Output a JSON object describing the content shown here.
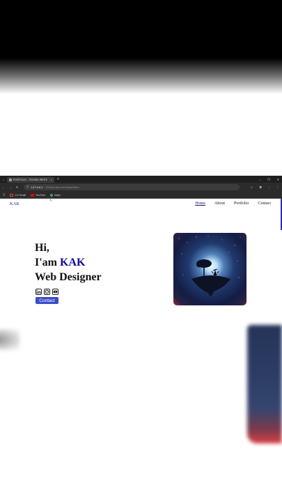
{
  "browser": {
    "tab_title": "PORTFOLIO - TECHNO WRITE",
    "tab_close": "×",
    "new_tab": "+",
    "url_host": "127.0.0.1",
    "url_path": ":5500/index.html#portfolio",
    "bookmarks": [
      {
        "label": "J-K Gmail",
        "icon": "gmail-icon"
      },
      {
        "label": "YouTube",
        "icon": "youtube-icon"
      },
      {
        "label": "Maps",
        "icon": "maps-icon"
      }
    ]
  },
  "site": {
    "logo": "KAK",
    "nav": [
      "Home",
      "About",
      "Portfolio",
      "Contact"
    ],
    "hero": {
      "greeting": "Hi,",
      "intro_prefix": "I'am ",
      "name": "KAK",
      "role": "Web Designer",
      "contact_button": "Contact",
      "socials": [
        "linkedin-icon",
        "github-icon",
        "youtube-icon"
      ]
    }
  },
  "colors": {
    "accent": "#0c0c9e",
    "button": "#3c4dc8",
    "chrome": "#2b2b2b"
  }
}
